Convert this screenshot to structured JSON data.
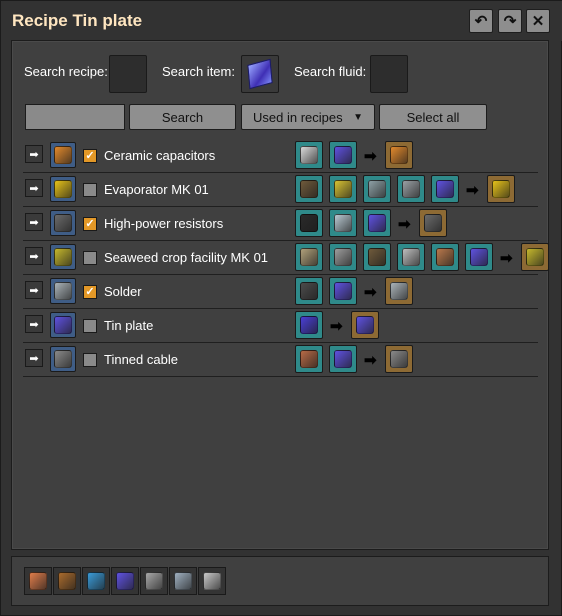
{
  "window": {
    "title": "Recipe Tin plate"
  },
  "titlebar_buttons": [
    {
      "icon": "undo-icon",
      "glyph": "↶"
    },
    {
      "icon": "redo-icon",
      "glyph": "↷"
    },
    {
      "icon": "close-icon",
      "glyph": "✕"
    }
  ],
  "search": {
    "recipe_label": "Search recipe:",
    "item_label": "Search item:",
    "fluid_label": "Search fluid:",
    "item_selected": "tin-plate-icon",
    "text_value": ""
  },
  "toolbar": {
    "search_label": "Search",
    "dropdown_selected": "Used in recipes",
    "dropdown_arrow": "▼",
    "select_all_label": "Select all"
  },
  "recipes": [
    {
      "name": "Ceramic capacitors",
      "checked": true,
      "icon": "ceramic-capacitor-icon",
      "inputs": [
        "ceramic-icon",
        "tin-plate-icon"
      ],
      "outputs": [
        "ceramic-capacitor-icon"
      ]
    },
    {
      "name": "Evaporator MK 01",
      "checked": false,
      "icon": "evaporator-icon",
      "inputs": [
        "machine-part-icon",
        "tank-icon",
        "pipe-machine-icon",
        "steel-beam-icon",
        "tin-plate-icon"
      ],
      "outputs": [
        "evaporator-icon"
      ]
    },
    {
      "name": "High-power resistors",
      "checked": true,
      "icon": "resistor-icon",
      "inputs": [
        "graphite-icon",
        "wire-icon",
        "tin-plate-icon"
      ],
      "outputs": [
        "resistor-icon"
      ]
    },
    {
      "name": "Seaweed crop facility MK 01",
      "checked": false,
      "icon": "seaweed-facility-icon",
      "inputs": [
        "canister-icon",
        "steel-plate-icon",
        "machine-part-icon",
        "concrete-icon",
        "rod-icon",
        "tin-plate-icon"
      ],
      "outputs": [
        "seaweed-facility-icon"
      ]
    },
    {
      "name": "Solder",
      "checked": true,
      "icon": "solder-icon",
      "inputs": [
        "lead-plate-icon",
        "tin-plate-icon"
      ],
      "outputs": [
        "solder-icon"
      ]
    },
    {
      "name": "Tin plate",
      "checked": false,
      "icon": "tin-plate-icon",
      "inputs": [
        "tin-ore-icon"
      ],
      "outputs": [
        "tin-plate-icon"
      ]
    },
    {
      "name": "Tinned cable",
      "checked": false,
      "icon": "tinned-cable-icon",
      "inputs": [
        "copper-cable-icon",
        "tin-plate-icon"
      ],
      "outputs": [
        "tinned-cable-icon"
      ]
    }
  ],
  "row_arrow_glyph": "➡",
  "history": [
    "copper-plate-icon",
    "circuit-icon",
    "water-drop-icon",
    "tin-plate-icon",
    "stone-icon",
    "wire-bundle-icon",
    "iron-plate-icon"
  ],
  "colors": {
    "accent": "#e39827",
    "title": "#ffe6c0",
    "teal_slot": "#2f8a8a",
    "result_slot": "#8d6a34"
  }
}
